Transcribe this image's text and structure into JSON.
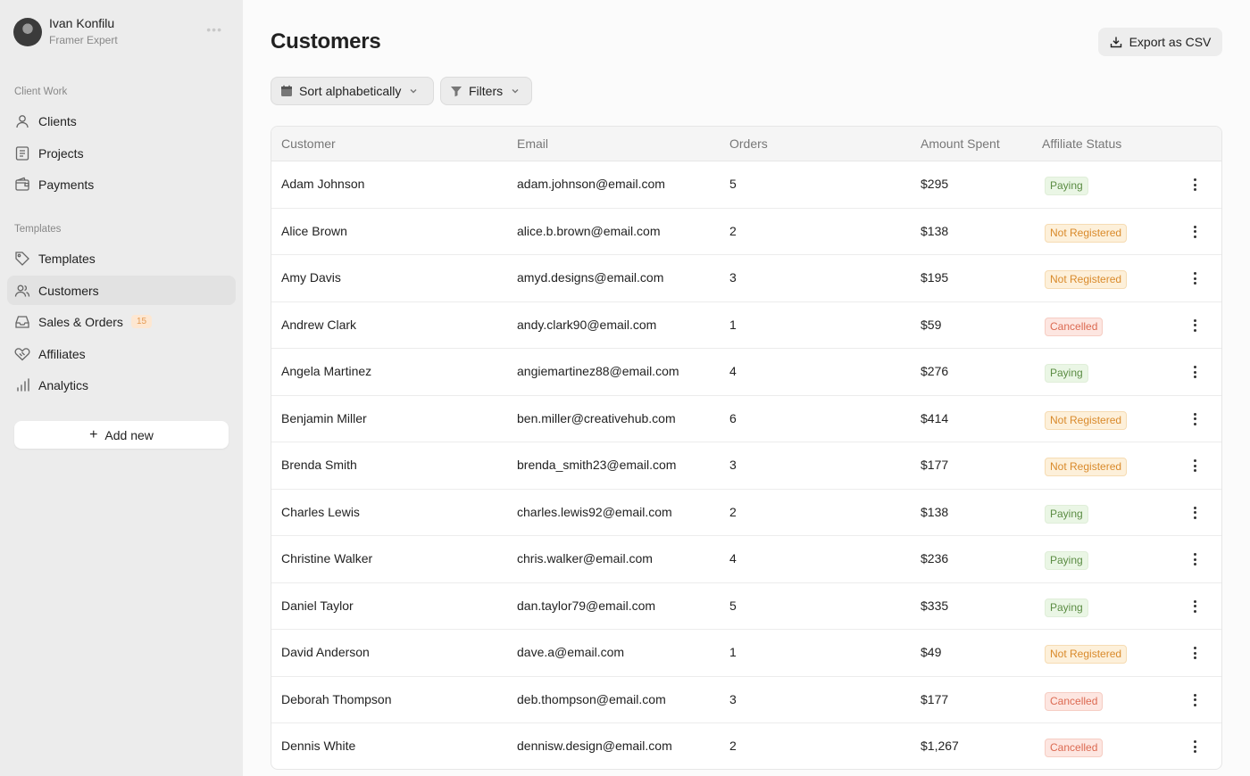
{
  "user": {
    "name": "Ivan Konfilu",
    "role": "Framer Expert"
  },
  "sidebar": {
    "sections": [
      {
        "label": "Client Work",
        "items": [
          {
            "label": "Clients",
            "icon": "user-icon"
          },
          {
            "label": "Projects",
            "icon": "document-icon"
          },
          {
            "label": "Payments",
            "icon": "wallet-icon"
          }
        ]
      },
      {
        "label": "Templates",
        "items": [
          {
            "label": "Templates",
            "icon": "tag-icon"
          },
          {
            "label": "Customers",
            "icon": "users-icon",
            "active": true
          },
          {
            "label": "Sales & Orders",
            "icon": "inbox-icon",
            "badge": "15"
          },
          {
            "label": "Affiliates",
            "icon": "handshake-icon"
          },
          {
            "label": "Analytics",
            "icon": "bar-chart-icon"
          }
        ]
      }
    ],
    "add_new": "Add new"
  },
  "page": {
    "title": "Customers",
    "export_label": "Export as CSV"
  },
  "toolbar": {
    "sort_label": "Sort alphabetically",
    "filters_label": "Filters"
  },
  "table": {
    "columns": [
      "Customer",
      "Email",
      "Orders",
      "Amount Spent",
      "Affiliate Status"
    ],
    "rows": [
      {
        "customer": "Adam Johnson",
        "email": "adam.johnson@email.com",
        "orders": "5",
        "amount": "$295",
        "status": "Paying"
      },
      {
        "customer": "Alice Brown",
        "email": "alice.b.brown@email.com",
        "orders": "2",
        "amount": "$138",
        "status": "Not Registered"
      },
      {
        "customer": "Amy Davis",
        "email": "amyd.designs@email.com",
        "orders": "3",
        "amount": "$195",
        "status": "Not Registered"
      },
      {
        "customer": "Andrew Clark",
        "email": "andy.clark90@email.com",
        "orders": "1",
        "amount": "$59",
        "status": "Cancelled"
      },
      {
        "customer": "Angela Martinez",
        "email": "angiemartinez88@email.com",
        "orders": "4",
        "amount": "$276",
        "status": "Paying"
      },
      {
        "customer": "Benjamin Miller",
        "email": "ben.miller@creativehub.com",
        "orders": "6",
        "amount": "$414",
        "status": "Not Registered"
      },
      {
        "customer": "Brenda Smith",
        "email": "brenda_smith23@email.com",
        "orders": "3",
        "amount": "$177",
        "status": "Not Registered"
      },
      {
        "customer": "Charles Lewis",
        "email": "charles.lewis92@email.com",
        "orders": "2",
        "amount": "$138",
        "status": "Paying"
      },
      {
        "customer": "Christine Walker",
        "email": "chris.walker@email.com",
        "orders": "4",
        "amount": "$236",
        "status": "Paying"
      },
      {
        "customer": "Daniel Taylor",
        "email": "dan.taylor79@email.com",
        "orders": "5",
        "amount": "$335",
        "status": "Paying"
      },
      {
        "customer": "David Anderson",
        "email": "dave.a@email.com",
        "orders": "1",
        "amount": "$49",
        "status": "Not Registered"
      },
      {
        "customer": "Deborah Thompson",
        "email": "deb.thompson@email.com",
        "orders": "3",
        "amount": "$177",
        "status": "Cancelled"
      },
      {
        "customer": "Dennis White",
        "email": "dennisw.design@email.com",
        "orders": "2",
        "amount": "$1,267",
        "status": "Cancelled"
      }
    ]
  },
  "colors": {
    "paying": "#5b8c43",
    "not_registered": "#d98a2b",
    "cancelled": "#dc6a52",
    "badge": "#e59a53"
  }
}
